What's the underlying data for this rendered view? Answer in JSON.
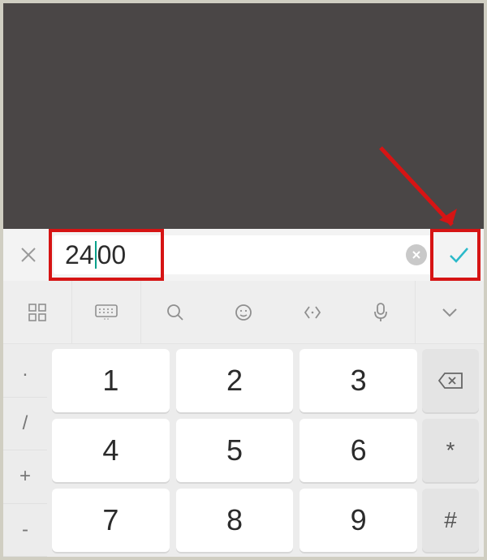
{
  "input": {
    "value_before_caret": "24",
    "value_after_caret": "00"
  },
  "symbols": {
    "dot": ".",
    "slash": "/",
    "plus": "+",
    "minus": "-"
  },
  "keys": {
    "k1": "1",
    "k2": "2",
    "k3": "3",
    "k4": "4",
    "k5": "5",
    "k6": "6",
    "k7": "7",
    "k8": "8",
    "k9": "9"
  },
  "right": {
    "star": "*",
    "hash": "#"
  }
}
